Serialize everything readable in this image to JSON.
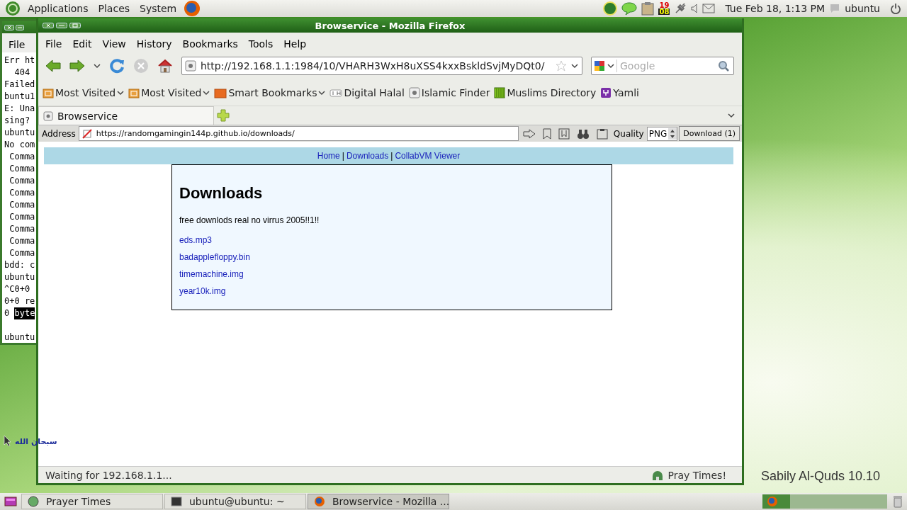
{
  "top_panel": {
    "menus": [
      "Applications",
      "Places",
      "System"
    ],
    "calendar_day": "19",
    "calendar_month": "08",
    "clock": "Tue Feb 18,  1:13 PM",
    "user": "ubuntu"
  },
  "terminal": {
    "menu": "File",
    "lines": [
      {
        "kind": "text",
        "text": "Err ht"
      },
      {
        "kind": "text",
        "text": "  404"
      },
      {
        "kind": "text",
        "text": "Failed"
      },
      {
        "kind": "text",
        "text": "buntu1"
      },
      {
        "kind": "text",
        "text": "E: Una"
      },
      {
        "kind": "text",
        "text": "sing?"
      },
      {
        "kind": "text",
        "text": "ubuntu"
      },
      {
        "kind": "text",
        "text": "No com"
      },
      {
        "kind": "text",
        "text": " Comma"
      },
      {
        "kind": "text",
        "text": " Comma"
      },
      {
        "kind": "text",
        "text": " Comma"
      },
      {
        "kind": "text",
        "text": " Comma"
      },
      {
        "kind": "text",
        "text": " Comma"
      },
      {
        "kind": "text",
        "text": " Comma"
      },
      {
        "kind": "text",
        "text": " Comma"
      },
      {
        "kind": "text",
        "text": " Comma"
      },
      {
        "kind": "text",
        "text": " Comma"
      },
      {
        "kind": "text",
        "text": "bdd: c"
      },
      {
        "kind": "text",
        "text": "ubuntu"
      },
      {
        "kind": "text",
        "text": "^C0+0"
      },
      {
        "kind": "text",
        "text": "0+0 re"
      },
      {
        "kind": "text",
        "text": "0 ",
        "selected_text": "byte"
      },
      {
        "kind": "blank"
      },
      {
        "kind": "text",
        "text": "ubuntu"
      }
    ]
  },
  "firefox": {
    "title": "Browservice - Mozilla Firefox",
    "menus": [
      "File",
      "Edit",
      "View",
      "History",
      "Bookmarks",
      "Tools",
      "Help"
    ],
    "url": "http://192.168.1.1:1984/10/VHARH3WxH8uXSS4kxxBskldSvjMyDQt0/",
    "search_placeholder": "Google",
    "bookmarks": [
      {
        "label": "Most Visited",
        "kind": "folder",
        "dropdown": true
      },
      {
        "label": "Most Visited",
        "kind": "folder",
        "dropdown": true
      },
      {
        "label": "Smart Bookmarks",
        "kind": "smart",
        "dropdown": true
      },
      {
        "label": "Digital Halal",
        "kind": "dh",
        "dropdown": false
      },
      {
        "label": "Islamic Finder",
        "kind": "page",
        "dropdown": false
      },
      {
        "label": "Muslims Directory",
        "kind": "grid",
        "dropdown": false
      },
      {
        "label": "Yamli",
        "kind": "yamli",
        "dropdown": false
      }
    ],
    "tabs": [
      {
        "label": "Browservice",
        "selected": true
      }
    ],
    "address_bar": {
      "label": "Address",
      "url": "https://randomgamingin144p.github.io/downloads/",
      "quality_label": "Quality",
      "quality": "PNG",
      "download_button": "Download (1)"
    },
    "page": {
      "nav": [
        {
          "label": "Home"
        },
        {
          "label": "Downloads"
        },
        {
          "label": "CollabVM Viewer"
        }
      ],
      "separator": "|",
      "heading": "Downloads",
      "text": "free downlods real no virrus 2005!!1!!",
      "links": [
        "eds.mp3",
        "badapplefloppy.bin",
        "timemachine.img",
        "year10k.img"
      ]
    },
    "status": "Waiting for 192.168.1.1...",
    "status_addon": "Pray Times!"
  },
  "desktop": {
    "arabic_text": "سبحان الله",
    "brand": "Sabily Al-Quds 10.10"
  },
  "taskbar": [
    {
      "label": "Prayer Times",
      "kind": "prayer",
      "selected": false
    },
    {
      "label": "ubuntu@ubuntu: ~",
      "kind": "terminal",
      "selected": false
    },
    {
      "label": "Browservice - Mozilla ...",
      "kind": "firefox",
      "selected": true
    }
  ]
}
